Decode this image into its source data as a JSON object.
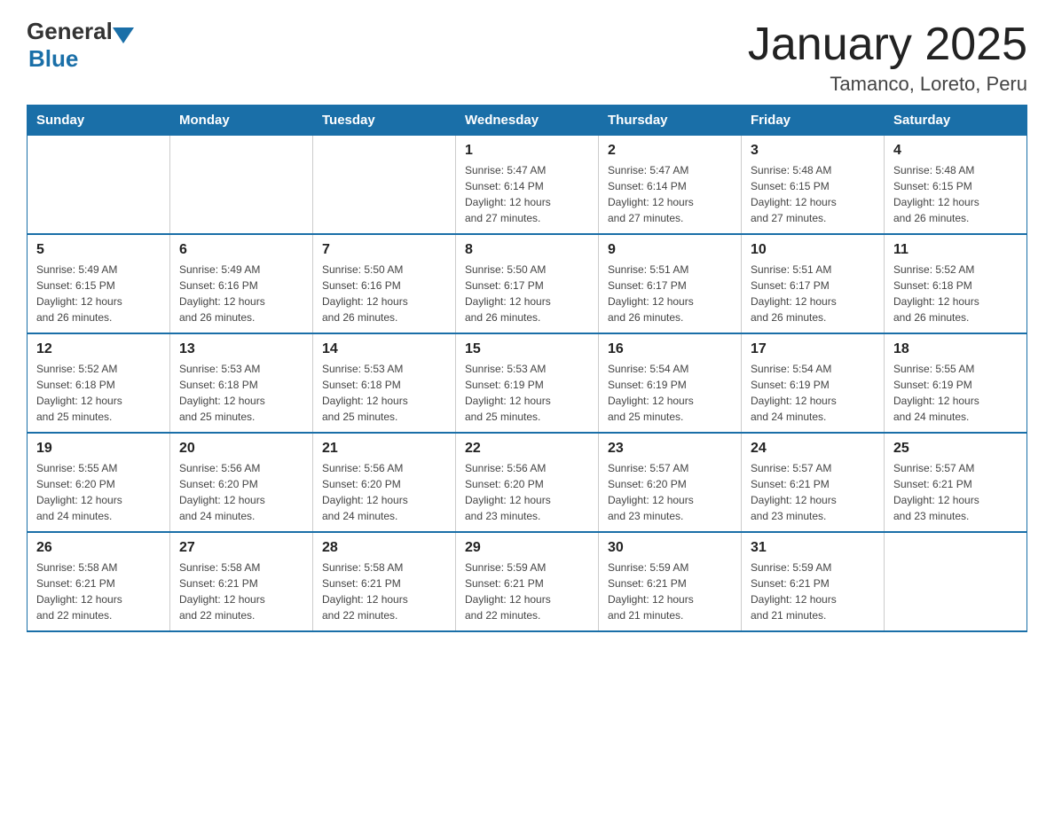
{
  "header": {
    "logo_general": "General",
    "logo_blue": "Blue",
    "title": "January 2025",
    "subtitle": "Tamanco, Loreto, Peru"
  },
  "days_of_week": [
    "Sunday",
    "Monday",
    "Tuesday",
    "Wednesday",
    "Thursday",
    "Friday",
    "Saturday"
  ],
  "weeks": [
    [
      {
        "day": "",
        "info": ""
      },
      {
        "day": "",
        "info": ""
      },
      {
        "day": "",
        "info": ""
      },
      {
        "day": "1",
        "info": "Sunrise: 5:47 AM\nSunset: 6:14 PM\nDaylight: 12 hours\nand 27 minutes."
      },
      {
        "day": "2",
        "info": "Sunrise: 5:47 AM\nSunset: 6:14 PM\nDaylight: 12 hours\nand 27 minutes."
      },
      {
        "day": "3",
        "info": "Sunrise: 5:48 AM\nSunset: 6:15 PM\nDaylight: 12 hours\nand 27 minutes."
      },
      {
        "day": "4",
        "info": "Sunrise: 5:48 AM\nSunset: 6:15 PM\nDaylight: 12 hours\nand 26 minutes."
      }
    ],
    [
      {
        "day": "5",
        "info": "Sunrise: 5:49 AM\nSunset: 6:15 PM\nDaylight: 12 hours\nand 26 minutes."
      },
      {
        "day": "6",
        "info": "Sunrise: 5:49 AM\nSunset: 6:16 PM\nDaylight: 12 hours\nand 26 minutes."
      },
      {
        "day": "7",
        "info": "Sunrise: 5:50 AM\nSunset: 6:16 PM\nDaylight: 12 hours\nand 26 minutes."
      },
      {
        "day": "8",
        "info": "Sunrise: 5:50 AM\nSunset: 6:17 PM\nDaylight: 12 hours\nand 26 minutes."
      },
      {
        "day": "9",
        "info": "Sunrise: 5:51 AM\nSunset: 6:17 PM\nDaylight: 12 hours\nand 26 minutes."
      },
      {
        "day": "10",
        "info": "Sunrise: 5:51 AM\nSunset: 6:17 PM\nDaylight: 12 hours\nand 26 minutes."
      },
      {
        "day": "11",
        "info": "Sunrise: 5:52 AM\nSunset: 6:18 PM\nDaylight: 12 hours\nand 26 minutes."
      }
    ],
    [
      {
        "day": "12",
        "info": "Sunrise: 5:52 AM\nSunset: 6:18 PM\nDaylight: 12 hours\nand 25 minutes."
      },
      {
        "day": "13",
        "info": "Sunrise: 5:53 AM\nSunset: 6:18 PM\nDaylight: 12 hours\nand 25 minutes."
      },
      {
        "day": "14",
        "info": "Sunrise: 5:53 AM\nSunset: 6:18 PM\nDaylight: 12 hours\nand 25 minutes."
      },
      {
        "day": "15",
        "info": "Sunrise: 5:53 AM\nSunset: 6:19 PM\nDaylight: 12 hours\nand 25 minutes."
      },
      {
        "day": "16",
        "info": "Sunrise: 5:54 AM\nSunset: 6:19 PM\nDaylight: 12 hours\nand 25 minutes."
      },
      {
        "day": "17",
        "info": "Sunrise: 5:54 AM\nSunset: 6:19 PM\nDaylight: 12 hours\nand 24 minutes."
      },
      {
        "day": "18",
        "info": "Sunrise: 5:55 AM\nSunset: 6:19 PM\nDaylight: 12 hours\nand 24 minutes."
      }
    ],
    [
      {
        "day": "19",
        "info": "Sunrise: 5:55 AM\nSunset: 6:20 PM\nDaylight: 12 hours\nand 24 minutes."
      },
      {
        "day": "20",
        "info": "Sunrise: 5:56 AM\nSunset: 6:20 PM\nDaylight: 12 hours\nand 24 minutes."
      },
      {
        "day": "21",
        "info": "Sunrise: 5:56 AM\nSunset: 6:20 PM\nDaylight: 12 hours\nand 24 minutes."
      },
      {
        "day": "22",
        "info": "Sunrise: 5:56 AM\nSunset: 6:20 PM\nDaylight: 12 hours\nand 23 minutes."
      },
      {
        "day": "23",
        "info": "Sunrise: 5:57 AM\nSunset: 6:20 PM\nDaylight: 12 hours\nand 23 minutes."
      },
      {
        "day": "24",
        "info": "Sunrise: 5:57 AM\nSunset: 6:21 PM\nDaylight: 12 hours\nand 23 minutes."
      },
      {
        "day": "25",
        "info": "Sunrise: 5:57 AM\nSunset: 6:21 PM\nDaylight: 12 hours\nand 23 minutes."
      }
    ],
    [
      {
        "day": "26",
        "info": "Sunrise: 5:58 AM\nSunset: 6:21 PM\nDaylight: 12 hours\nand 22 minutes."
      },
      {
        "day": "27",
        "info": "Sunrise: 5:58 AM\nSunset: 6:21 PM\nDaylight: 12 hours\nand 22 minutes."
      },
      {
        "day": "28",
        "info": "Sunrise: 5:58 AM\nSunset: 6:21 PM\nDaylight: 12 hours\nand 22 minutes."
      },
      {
        "day": "29",
        "info": "Sunrise: 5:59 AM\nSunset: 6:21 PM\nDaylight: 12 hours\nand 22 minutes."
      },
      {
        "day": "30",
        "info": "Sunrise: 5:59 AM\nSunset: 6:21 PM\nDaylight: 12 hours\nand 21 minutes."
      },
      {
        "day": "31",
        "info": "Sunrise: 5:59 AM\nSunset: 6:21 PM\nDaylight: 12 hours\nand 21 minutes."
      },
      {
        "day": "",
        "info": ""
      }
    ]
  ]
}
